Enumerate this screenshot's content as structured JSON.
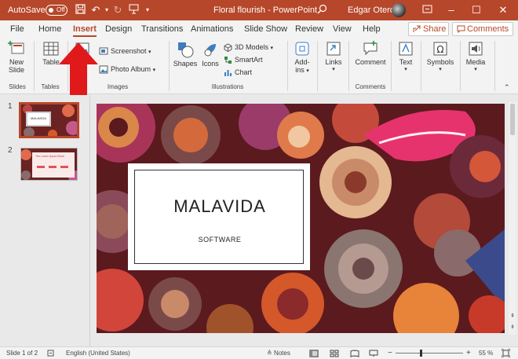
{
  "titlebar": {
    "autosave_label": "AutoSave",
    "autosave_state": "Off",
    "document_title": "Floral flourish - PowerPoint",
    "user_name": "Edgar Otero",
    "save_icon": "save-icon",
    "undo_icon": "undo-icon",
    "redo_icon": "redo-icon",
    "present_icon": "present-icon",
    "search_icon": "search-icon",
    "minimize": "–",
    "maximize": "☐",
    "close": "✕",
    "color": "#b7472a"
  },
  "tabs": [
    "File",
    "Home",
    "Insert",
    "Design",
    "Transitions",
    "Animations",
    "Slide Show",
    "Review",
    "View",
    "Help"
  ],
  "active_tab": "Insert",
  "share_label": "Share",
  "comments_label": "Comments",
  "ribbon": {
    "new_slide_label": "New",
    "new_slide_label2": "Slide",
    "table_label": "Table",
    "pictures_label": "Pi",
    "screenshot_label": "Screenshot",
    "photo_album_label": "Photo Album",
    "shapes_label": "Shapes",
    "icons_label": "Icons",
    "models_label": "3D Models",
    "smartart_label": "SmartArt",
    "chart_label": "Chart",
    "addins_label": "Add-",
    "addins_label2": "ins",
    "links_label": "Links",
    "comment_label": "Comment",
    "text_label": "Text",
    "symbols_label": "Symbols",
    "media_label": "Media",
    "groups": {
      "slides": "Slides",
      "tables": "Tables",
      "images": "Images",
      "illustrations": "Illustrations",
      "comments": "Comments"
    }
  },
  "slides_pane": {
    "items": [
      {
        "number": "1",
        "title": "MALAVIDA"
      },
      {
        "number": "2",
        "title": "The Lorem Ipsum Block"
      }
    ]
  },
  "slide": {
    "title": "MALAVIDA",
    "subtitle": "SOFTWARE"
  },
  "statusbar": {
    "slide_info": "Slide 1 of 2",
    "language": "English (United States)",
    "notes_label": "Notes",
    "zoom": "55 %",
    "minus": "−",
    "plus": "+"
  },
  "annotation_arrow_color": "#e0191b"
}
